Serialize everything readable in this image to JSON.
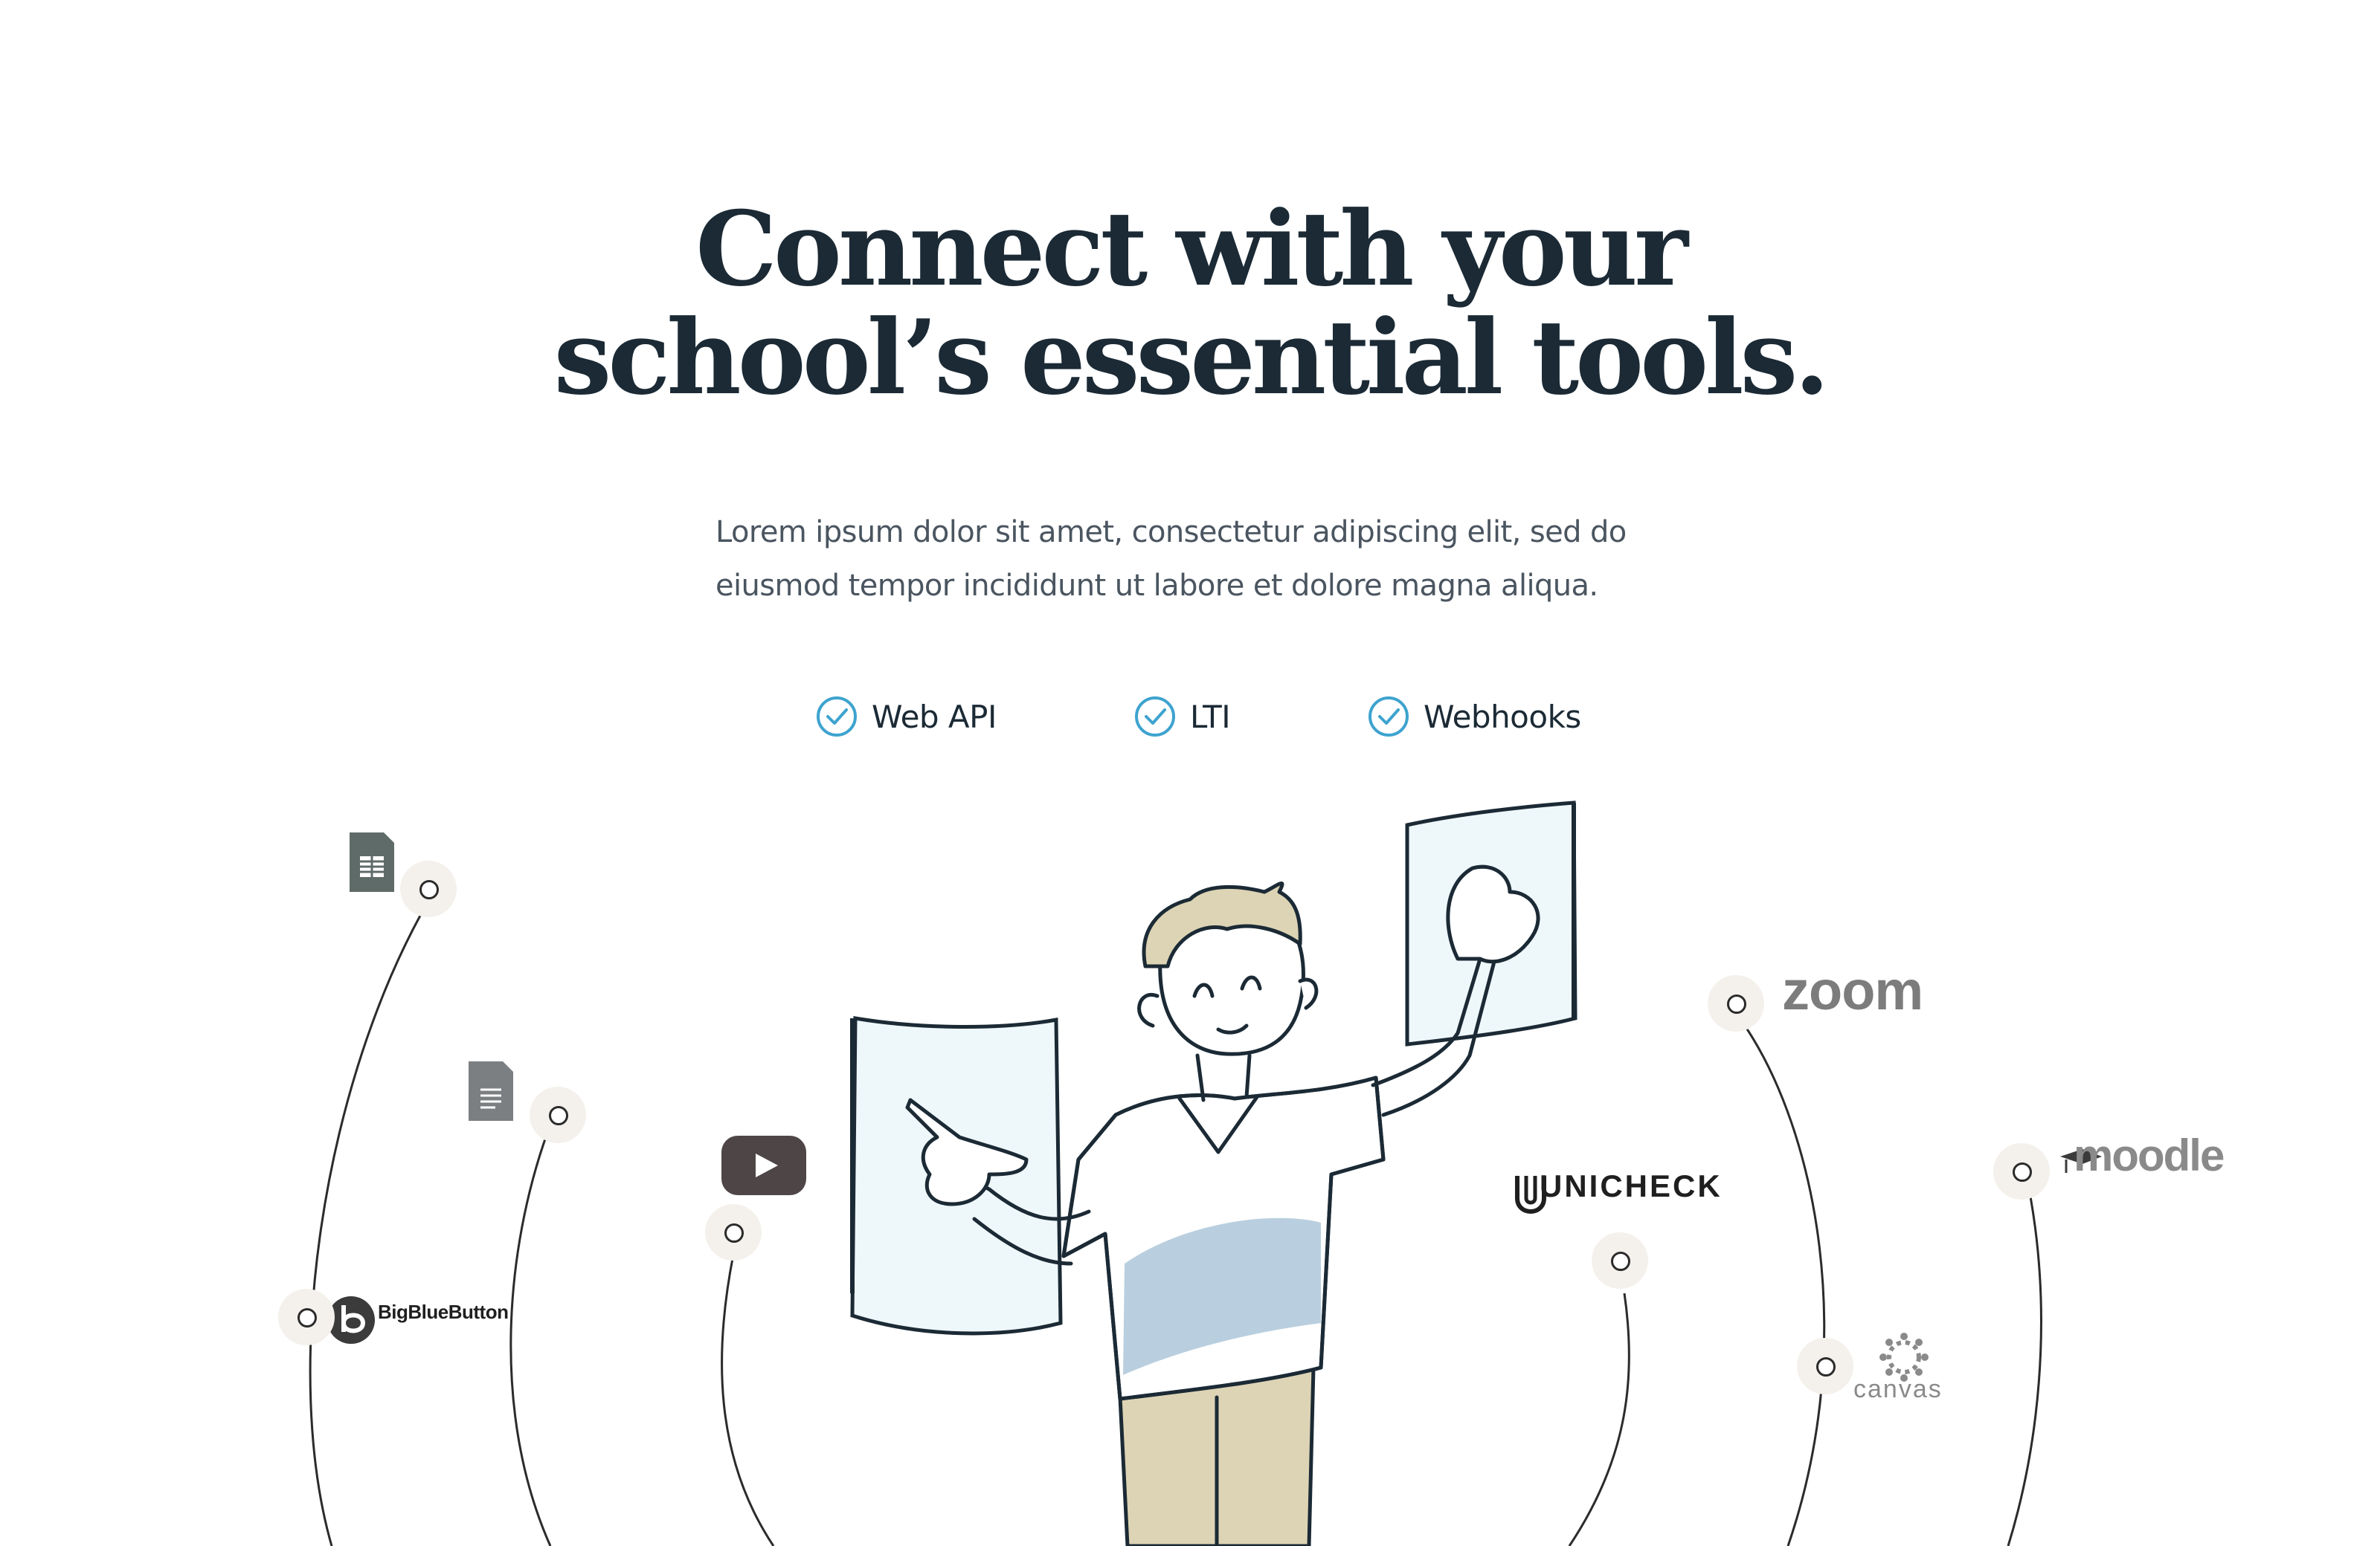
{
  "hero": {
    "headline_line1": "Connect with your",
    "headline_line2": "school’s essential tools.",
    "lead": "Lorem ipsum dolor sit amet, consectetur adipiscing elit, sed do eiusmod tempor incididunt ut labore et dolore magna aliqua."
  },
  "features": [
    {
      "label": "Web API",
      "icon": "check-circle-icon"
    },
    {
      "label": "LTI",
      "icon": "check-circle-icon"
    },
    {
      "label": "Webhooks",
      "icon": "check-circle-icon"
    }
  ],
  "integrations": {
    "google_sheets": {
      "icon": "google-sheets-icon"
    },
    "google_docs": {
      "icon": "google-docs-icon"
    },
    "youtube": {
      "icon": "youtube-icon"
    },
    "bigbluebutton": {
      "name": "BigBlueButton",
      "icon": "bigbluebutton-icon"
    },
    "zoom": {
      "name": "zoom"
    },
    "moodle": {
      "name": "moodle",
      "icon": "mortarboard-icon"
    },
    "unicheck": {
      "name": "UNICHECK",
      "icon": "unicheck-icon"
    },
    "canvas": {
      "name": "canvas",
      "icon": "canvas-icon"
    }
  },
  "colors": {
    "heading": "#1b2a35",
    "body_text": "#4a5560",
    "check_accent": "#3ea3cf",
    "shirt_stripe": "#b9cfdf",
    "pants": "#ddd4b5",
    "hair": "#ddd4b5",
    "panel_fill": "#eef7fa",
    "node_bg": "#f4f1ec"
  }
}
